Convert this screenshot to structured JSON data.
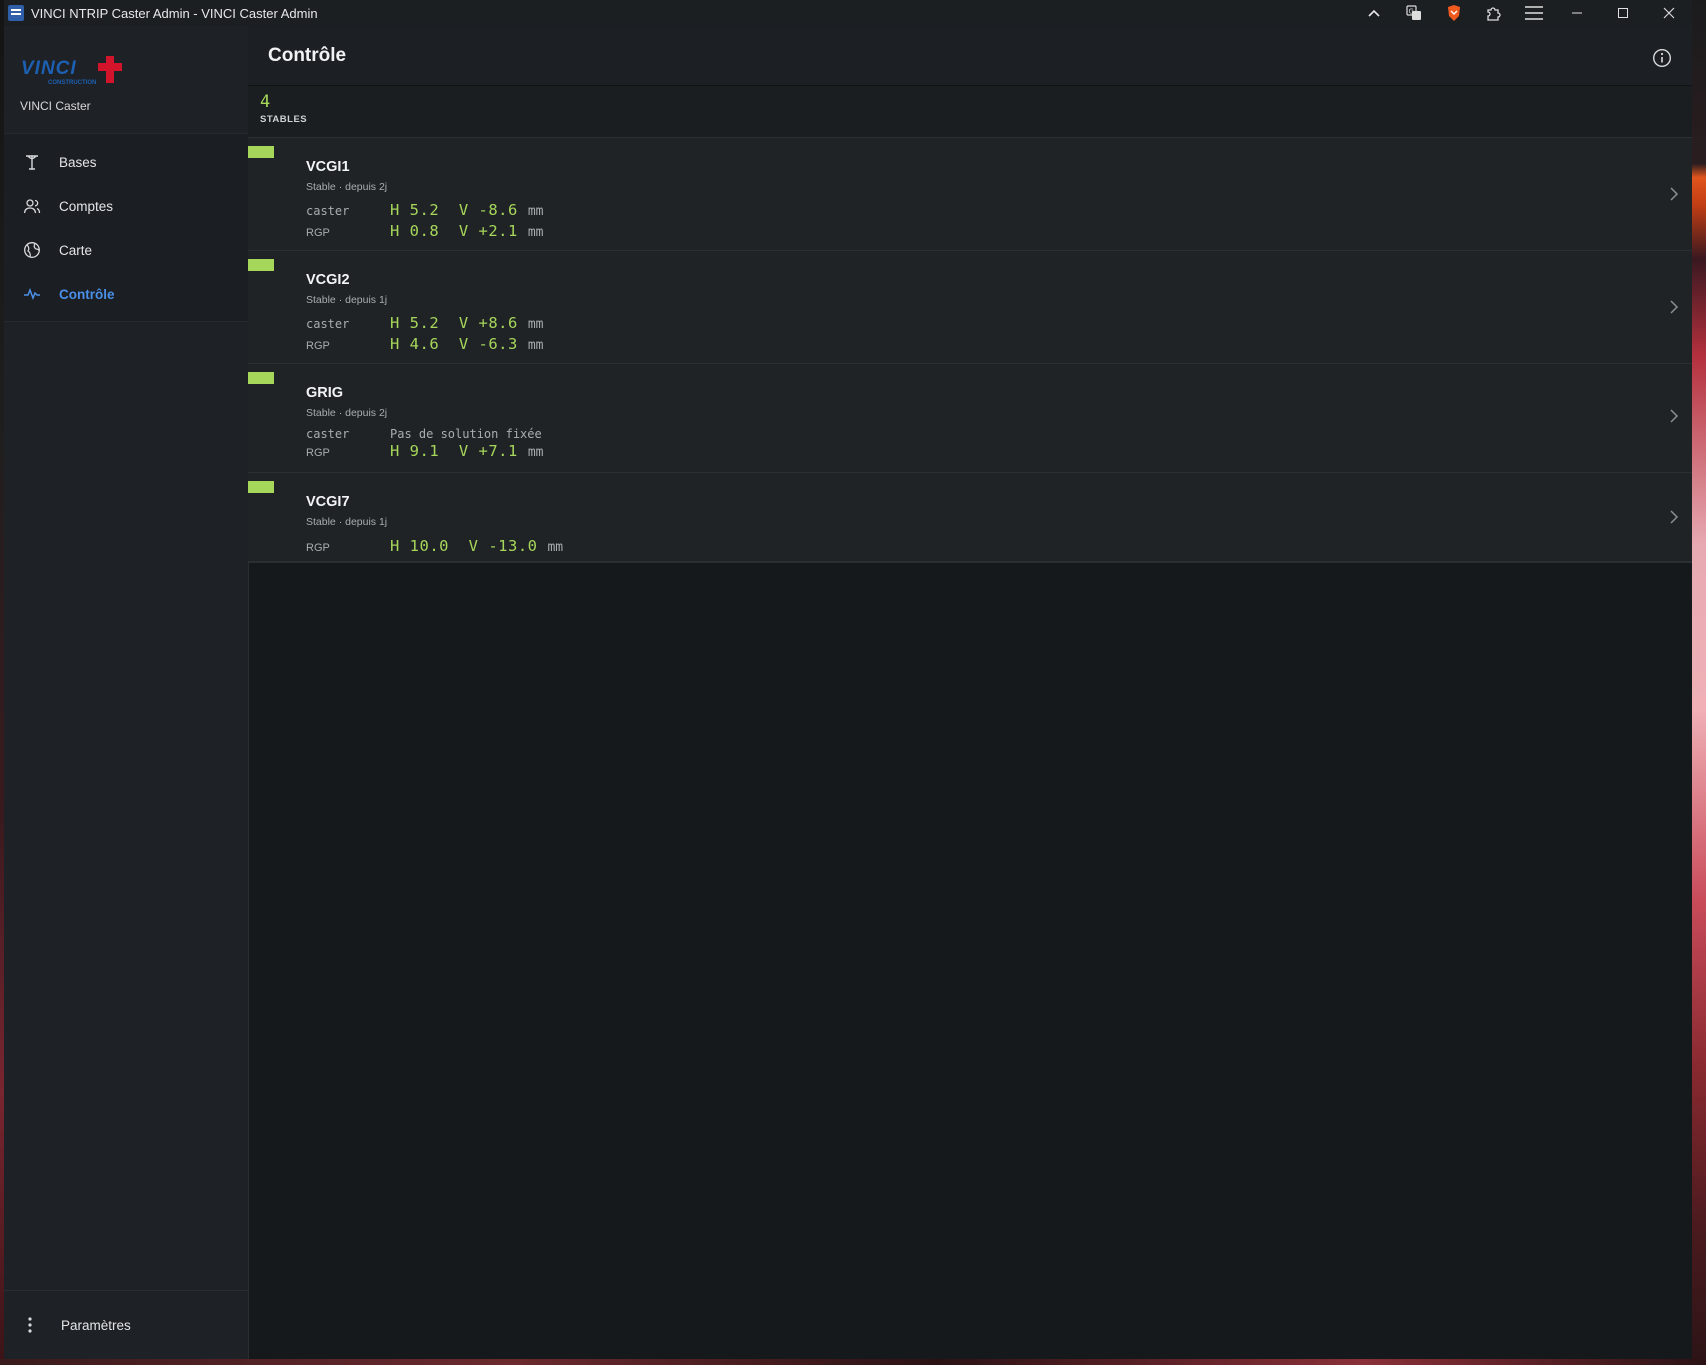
{
  "window": {
    "title": "VINCI NTRIP Caster Admin - VINCI Caster Admin",
    "toolbar_icons": [
      "chevron-up-icon",
      "translate-icon",
      "brave-shield-icon",
      "extensions-icon",
      "menu-icon"
    ],
    "controls": [
      "minimize-icon",
      "maximize-icon",
      "close-icon"
    ]
  },
  "sidebar": {
    "brand_name": "VINCI Caster",
    "logo_text": "VINCI CONSTRUCTION",
    "items": [
      {
        "label": "Bases",
        "icon": "antenna-icon",
        "active": false
      },
      {
        "label": "Comptes",
        "icon": "users-icon",
        "active": false
      },
      {
        "label": "Carte",
        "icon": "globe-icon",
        "active": false
      },
      {
        "label": "Contrôle",
        "icon": "activity-icon",
        "active": true
      }
    ],
    "settings_label": "Paramètres"
  },
  "header": {
    "title": "Contrôle",
    "info_icon": "info-icon"
  },
  "summary": {
    "count": "4",
    "label": "STABLES"
  },
  "stations": [
    {
      "name": "VCGI1",
      "status": "Stable · depuis 2j",
      "rows": [
        {
          "label": "caster",
          "value": "H 5.2  V -8.6",
          "unit": "mm"
        },
        {
          "label": "RGP",
          "value": "H 0.8  V +2.1",
          "unit": "mm"
        }
      ]
    },
    {
      "name": "VCGI2",
      "status": "Stable · depuis 1j",
      "rows": [
        {
          "label": "caster",
          "value": "H 5.2  V +8.6",
          "unit": "mm"
        },
        {
          "label": "RGP",
          "value": "H 4.6  V -6.3",
          "unit": "mm"
        }
      ]
    },
    {
      "name": "GRIG",
      "status": "Stable · depuis 2j",
      "rows": [
        {
          "label": "caster",
          "note": "Pas de solution fixée"
        },
        {
          "label": "RGP",
          "value": "H 9.1  V +7.1",
          "unit": "mm"
        }
      ]
    },
    {
      "name": "VCGI7",
      "status": "Stable · depuis 1j",
      "rows": [
        {
          "label": "RGP",
          "value": "H 10.0  V -13.0",
          "unit": "mm"
        }
      ]
    }
  ],
  "colors": {
    "accent_green": "#a6d65a",
    "accent_blue": "#4a8fe8",
    "background": "#16191c"
  }
}
